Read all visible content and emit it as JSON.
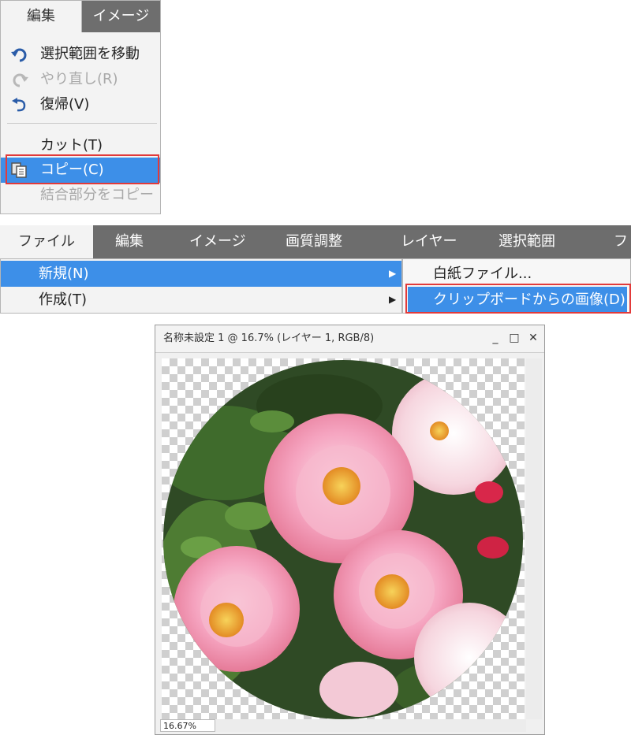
{
  "edit_menu": {
    "tabs": [
      "編集",
      "イメージ"
    ],
    "items": [
      {
        "label": "選択範囲を移動",
        "icon": "undo-icon",
        "disabled": false
      },
      {
        "label": "やり直し(R)",
        "icon": "redo-icon",
        "disabled": true
      },
      {
        "label": "復帰(V)",
        "icon": "revert-icon",
        "disabled": false
      },
      {
        "label": "カット(T)",
        "disabled": false
      },
      {
        "label": "コピー(C)",
        "icon": "copy-icon",
        "disabled": false,
        "selected": true
      },
      {
        "label": "結合部分をコピー",
        "disabled": true
      }
    ]
  },
  "file_menu": {
    "tabs": [
      "ファイル",
      "編集",
      "イメージ",
      "画質調整",
      "レイヤー",
      "選択範囲",
      "フ"
    ],
    "items": [
      {
        "label": "新規(N)",
        "selected": true
      },
      {
        "label": "作成(T)"
      }
    ],
    "submenu": [
      {
        "label": "白紙ファイル..."
      },
      {
        "label": "クリップボードからの画像(D)",
        "selected": true
      }
    ]
  },
  "document_window": {
    "title": "名称未設定 1 @ 16.7% (レイヤー 1, RGB/8)",
    "minimize": "_",
    "maximize": "□",
    "close": "✕",
    "zoom": "16.67%"
  },
  "colors": {
    "menubar": "#6d6d6d",
    "highlight": "#3d8fe8",
    "emphasis_border": "#e23a3a"
  }
}
